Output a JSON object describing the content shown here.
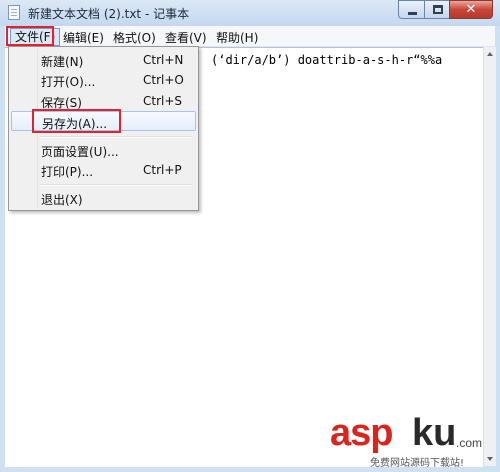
{
  "window": {
    "title": "新建文本文档 (2).txt - 记事本"
  },
  "menubar": {
    "items": [
      "文件(F)",
      "编辑(E)",
      "格式(O)",
      "查看(V)",
      "帮助(H)"
    ]
  },
  "editor": {
    "content": "(‘dir/a/b’) doattrib-a-s-h-r“%%a"
  },
  "file_menu": {
    "items": [
      {
        "label": "新建(N)",
        "shortcut": "Ctrl+N"
      },
      {
        "label": "打开(O)...",
        "shortcut": "Ctrl+O"
      },
      {
        "label": "保存(S)",
        "shortcut": "Ctrl+S"
      },
      {
        "label": "另存为(A)...",
        "shortcut": ""
      },
      {
        "label": "页面设置(U)...",
        "shortcut": ""
      },
      {
        "label": "打印(P)...",
        "shortcut": "Ctrl+P"
      },
      {
        "label": "退出(X)",
        "shortcut": ""
      }
    ]
  },
  "watermark": {
    "brand_red": "asp",
    "brand_dark": "ku",
    "suffix": ".com",
    "tagline": "免费网站源码下载站!"
  },
  "colors": {
    "highlight": "#e1232d",
    "title_bar": "#c3d8f0",
    "close_button": "#c7473a"
  }
}
